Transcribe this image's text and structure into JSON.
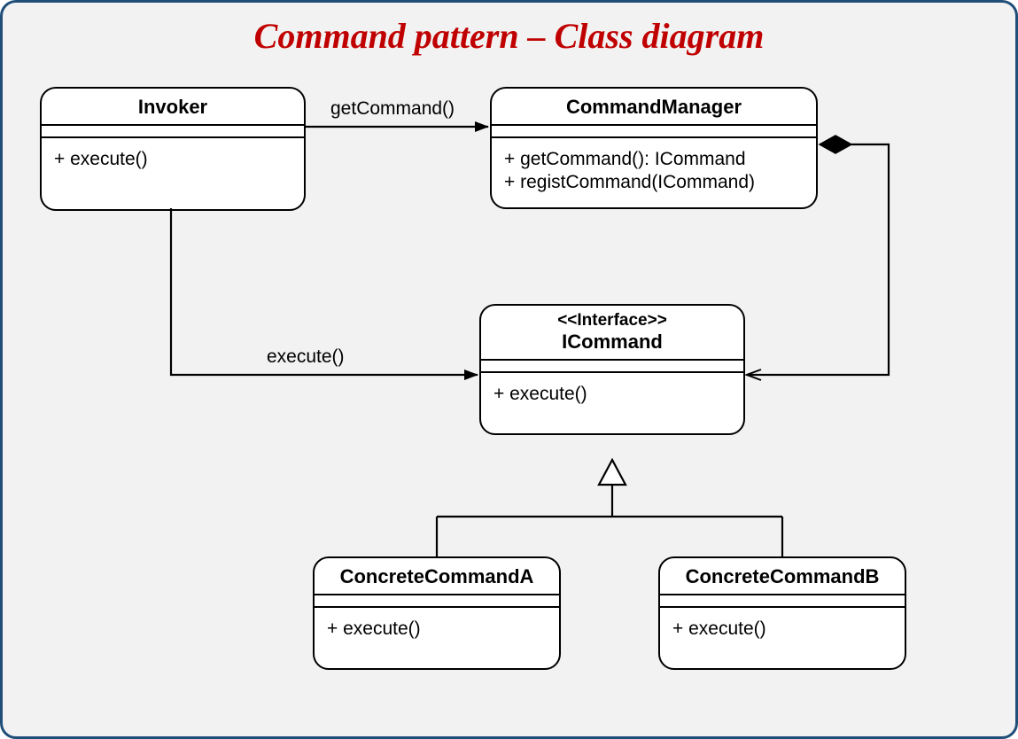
{
  "title": "Command pattern – Class diagram",
  "classes": {
    "invoker": {
      "name": "Invoker",
      "methods": [
        "+ execute()"
      ]
    },
    "commandManager": {
      "name": "CommandManager",
      "methods": [
        "+ getCommand(): ICommand",
        "+ registCommand(ICommand)"
      ]
    },
    "icommand": {
      "stereotype": "<<Interface>>",
      "name": "ICommand",
      "methods": [
        "+ execute()"
      ]
    },
    "concreteA": {
      "name": "ConcreteCommandA",
      "methods": [
        "+ execute()"
      ]
    },
    "concreteB": {
      "name": "ConcreteCommandB",
      "methods": [
        "+ execute()"
      ]
    }
  },
  "edgeLabels": {
    "getCommand": "getCommand()",
    "execute": "execute()"
  }
}
